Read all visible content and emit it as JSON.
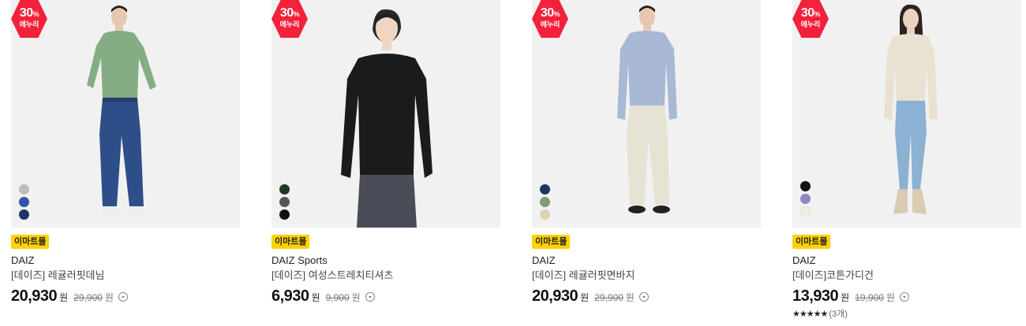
{
  "products": [
    {
      "badge_percent": "30",
      "badge_percent_sign": "%",
      "badge_label": "에누리",
      "mall": "이마트몰",
      "brand": "DAIZ",
      "title": "[데이즈] 레귤러핏데님",
      "price": "20,930",
      "price_unit": "원",
      "original_price": "29,900",
      "original_unit": "원",
      "swatches": [
        "#bdbdbd",
        "#2f56a8",
        "#1f3566"
      ]
    },
    {
      "badge_percent": "30",
      "badge_percent_sign": "%",
      "badge_label": "에누리",
      "mall": "이마트몰",
      "brand": "DAIZ Sports",
      "title": "[데이즈] 여성스트레치티셔츠",
      "price": "6,930",
      "price_unit": "원",
      "original_price": "9,900",
      "original_unit": "원",
      "swatches": [
        "#1d3a24",
        "#555555",
        "#111111"
      ]
    },
    {
      "badge_percent": "30",
      "badge_percent_sign": "%",
      "badge_label": "에누리",
      "mall": "이마트몰",
      "brand": "DAIZ",
      "title": "[데이즈] 레귤러핏면바지",
      "price": "20,930",
      "price_unit": "원",
      "original_price": "29,900",
      "original_unit": "원",
      "swatches": [
        "#22335e",
        "#7f9a78",
        "#e0d2b4"
      ]
    },
    {
      "badge_percent": "30",
      "badge_percent_sign": "%",
      "badge_label": "에누리",
      "mall": "이마트몰",
      "brand": "DAIZ",
      "title": "[데이즈]코튼가디건",
      "price": "13,930",
      "price_unit": "원",
      "original_price": "19,900",
      "original_unit": "원",
      "swatches": [
        "#111111",
        "#8c88c4",
        "#f3eee3"
      ],
      "rating_stars": "★★★★★",
      "rating_count": "(3개)"
    }
  ],
  "colors": {
    "sale_badge": "#f4213a",
    "mall_badge": "#ffd200",
    "thumb_bg": "#f1f1f1"
  }
}
